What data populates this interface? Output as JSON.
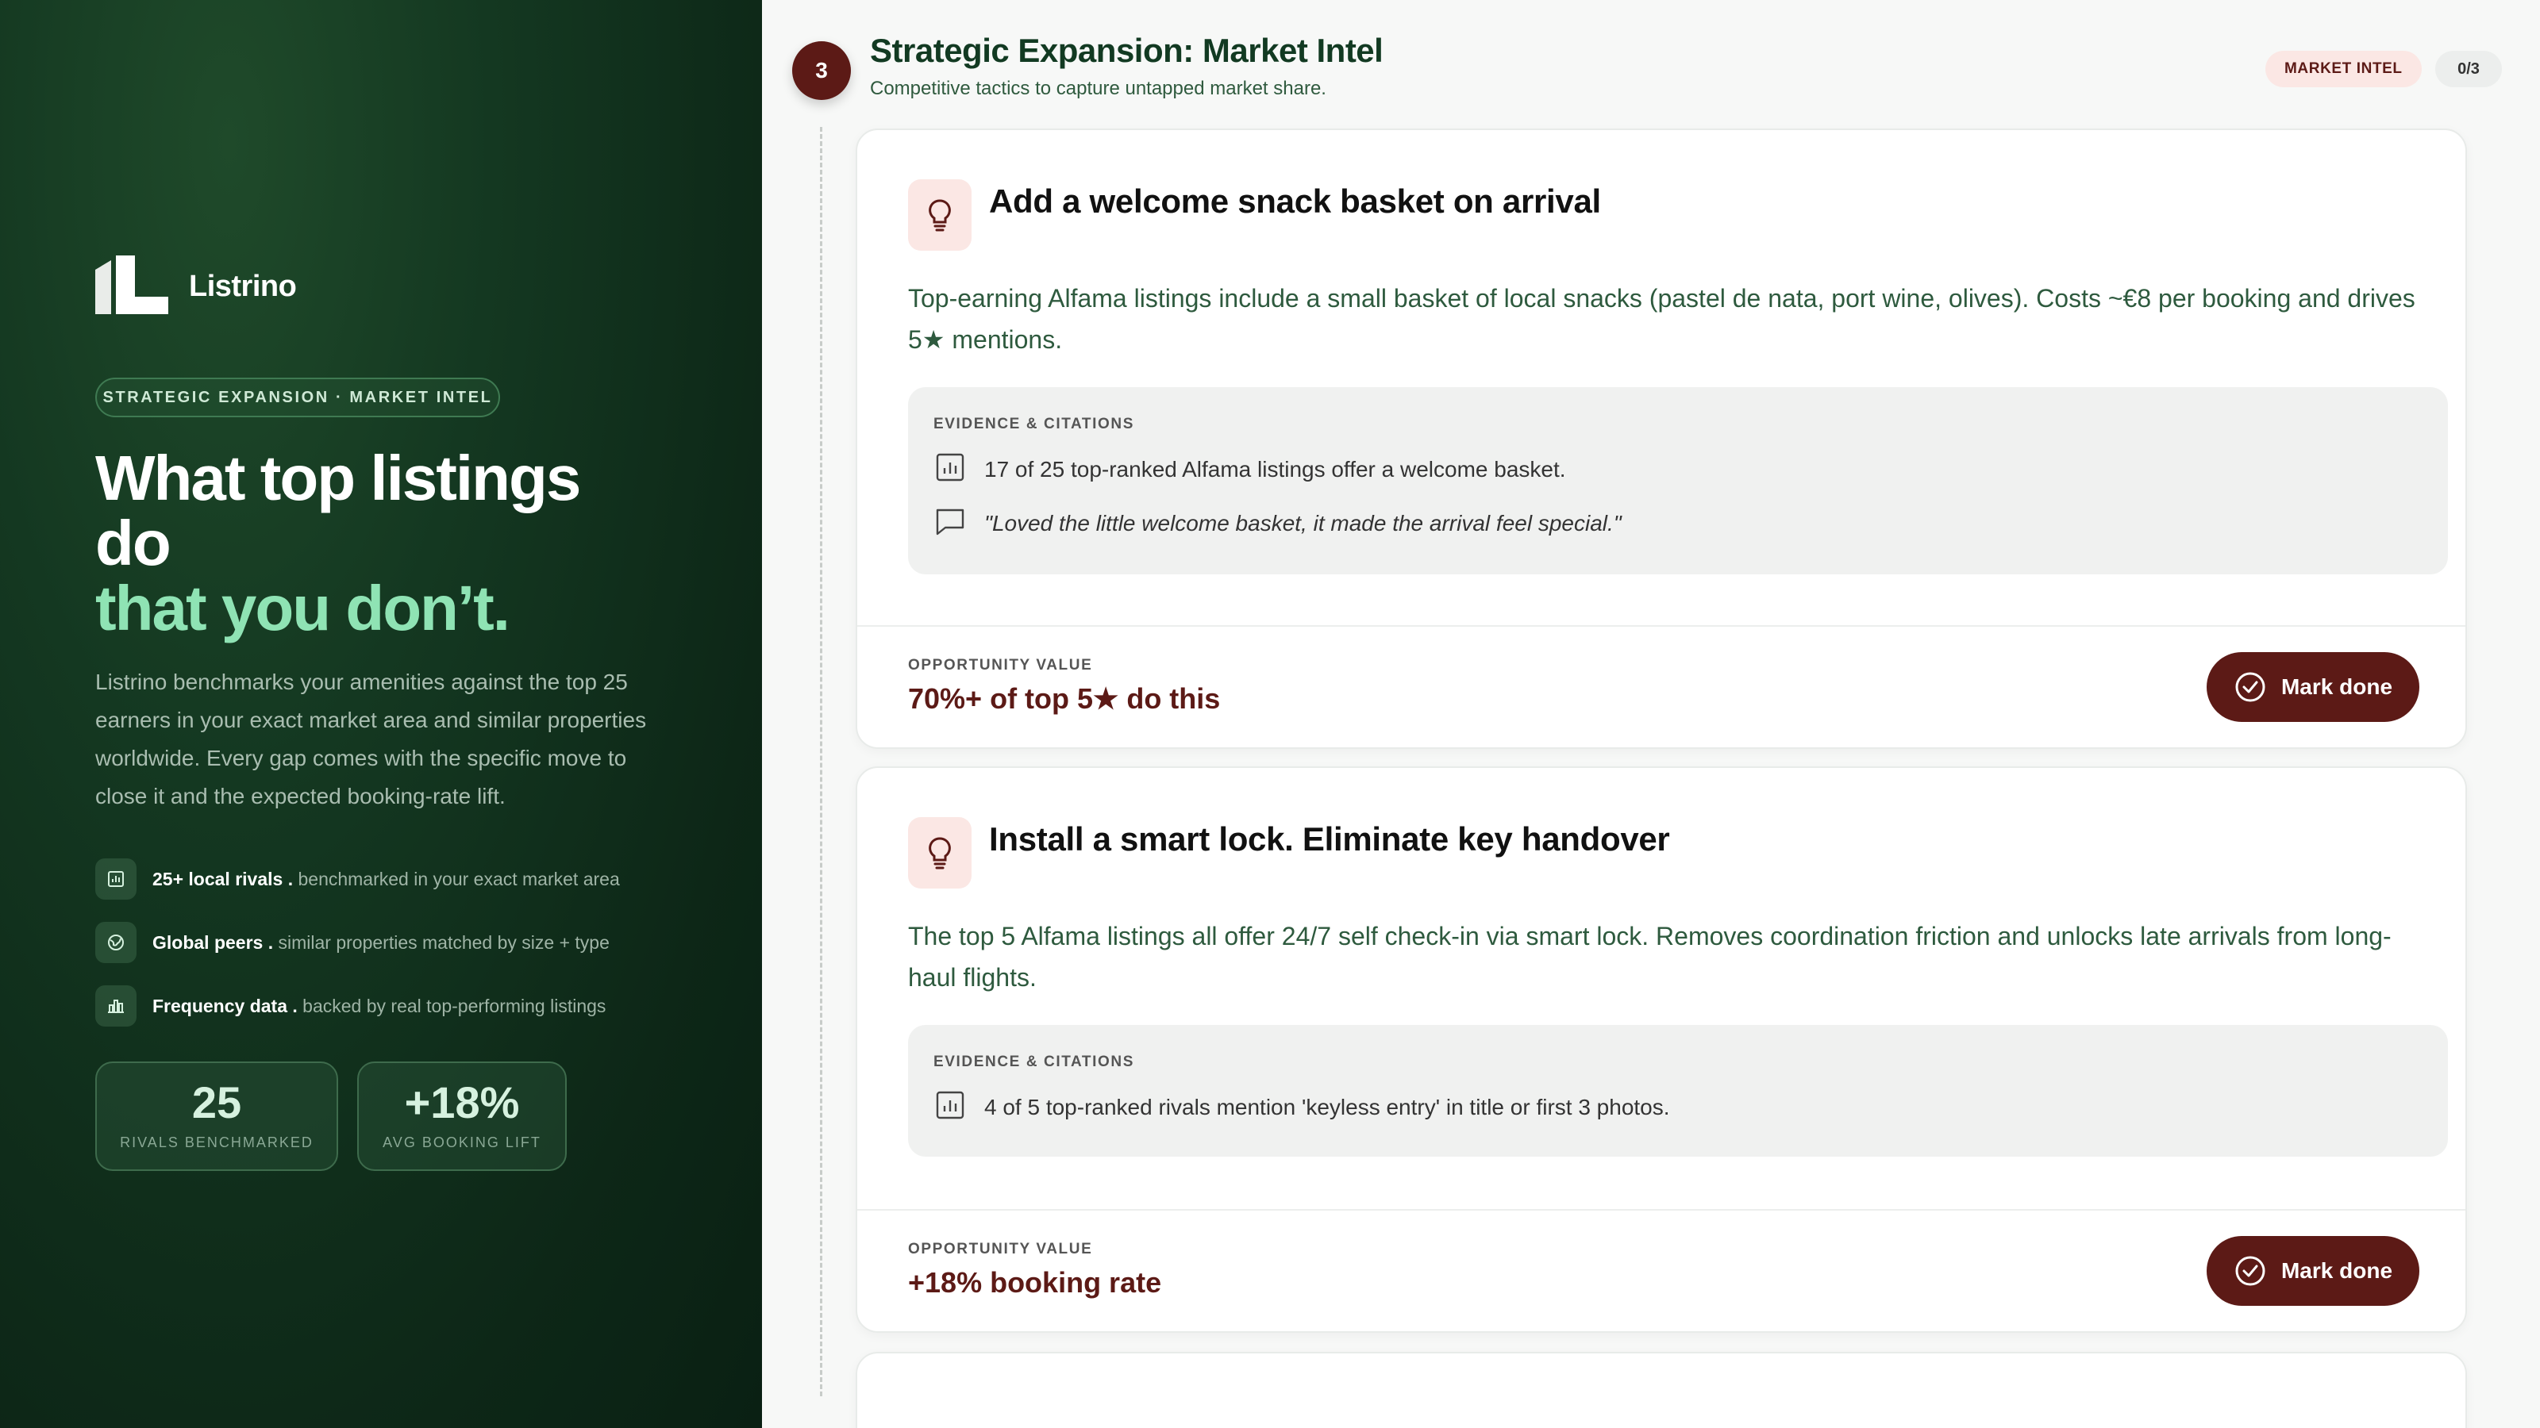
{
  "brand": {
    "name": "Listrino"
  },
  "left": {
    "pill": "STRATEGIC EXPANSION · MARKET INTEL",
    "hero": {
      "line1": "What top listings",
      "line2": "do",
      "line3": "that you don’t."
    },
    "intro": "Listrino benchmarks your amenities against the top 25 earners in your exact market area and similar properties worldwide. Every gap comes with the specific move to close it and the expected booking-rate lift.",
    "features": [
      {
        "icon": "chart-icon",
        "strong": "25+ local rivals .",
        "text": " benchmarked in your exact market area"
      },
      {
        "icon": "globe-icon",
        "strong": "Global peers .",
        "text": " similar properties matched by size + type"
      },
      {
        "icon": "bar-chart-icon",
        "strong": "Frequency data .",
        "text": " backed by real top-performing listings"
      }
    ],
    "stats": [
      {
        "value": "25",
        "label": "RIVALS BENCHMARKED"
      },
      {
        "value": "+18%",
        "label": "AVG BOOKING LIFT"
      }
    ]
  },
  "section": {
    "step": "3",
    "title": "Strategic Expansion: Market Intel",
    "subtitle": "Competitive tactics to capture untapped market share.",
    "badge": "MARKET INTEL",
    "count": "0/3"
  },
  "cards": [
    {
      "title": "Add a welcome snack basket on arrival",
      "description": "Top-earning Alfama listings include a small basket of local snacks (pastel de nata, port wine, olives). Costs ~€8 per booking and drives 5★ mentions.",
      "evidence_header": "EVIDENCE & CITATIONS",
      "evidence": [
        {
          "icon": "chart-icon",
          "text": "17 of 25 top-ranked Alfama listings offer a welcome basket."
        },
        {
          "icon": "comment-icon",
          "text": "\"Loved the little welcome basket, it made the arrival feel special.\""
        }
      ],
      "opportunity_label": "OPPORTUNITY VALUE",
      "opportunity_value": "70%+ of top 5★ do this",
      "button": "Mark done"
    },
    {
      "title": "Install a smart lock. Eliminate key handover",
      "description": "The top 5 Alfama listings all offer 24/7 self check-in via smart lock. Removes coordination friction and unlocks late arrivals from long-haul flights.",
      "evidence_header": "EVIDENCE & CITATIONS",
      "evidence": [
        {
          "icon": "chart-icon",
          "text": "4 of 5 top-ranked rivals mention 'keyless entry' in title or first 3 photos."
        }
      ],
      "opportunity_label": "OPPORTUNITY VALUE",
      "opportunity_value": "+18% booking rate",
      "button": "Mark done"
    }
  ],
  "colors": {
    "accent": "#5c1a16",
    "brand_green": "#123a22",
    "hero_mint": "#8fe3b4"
  }
}
